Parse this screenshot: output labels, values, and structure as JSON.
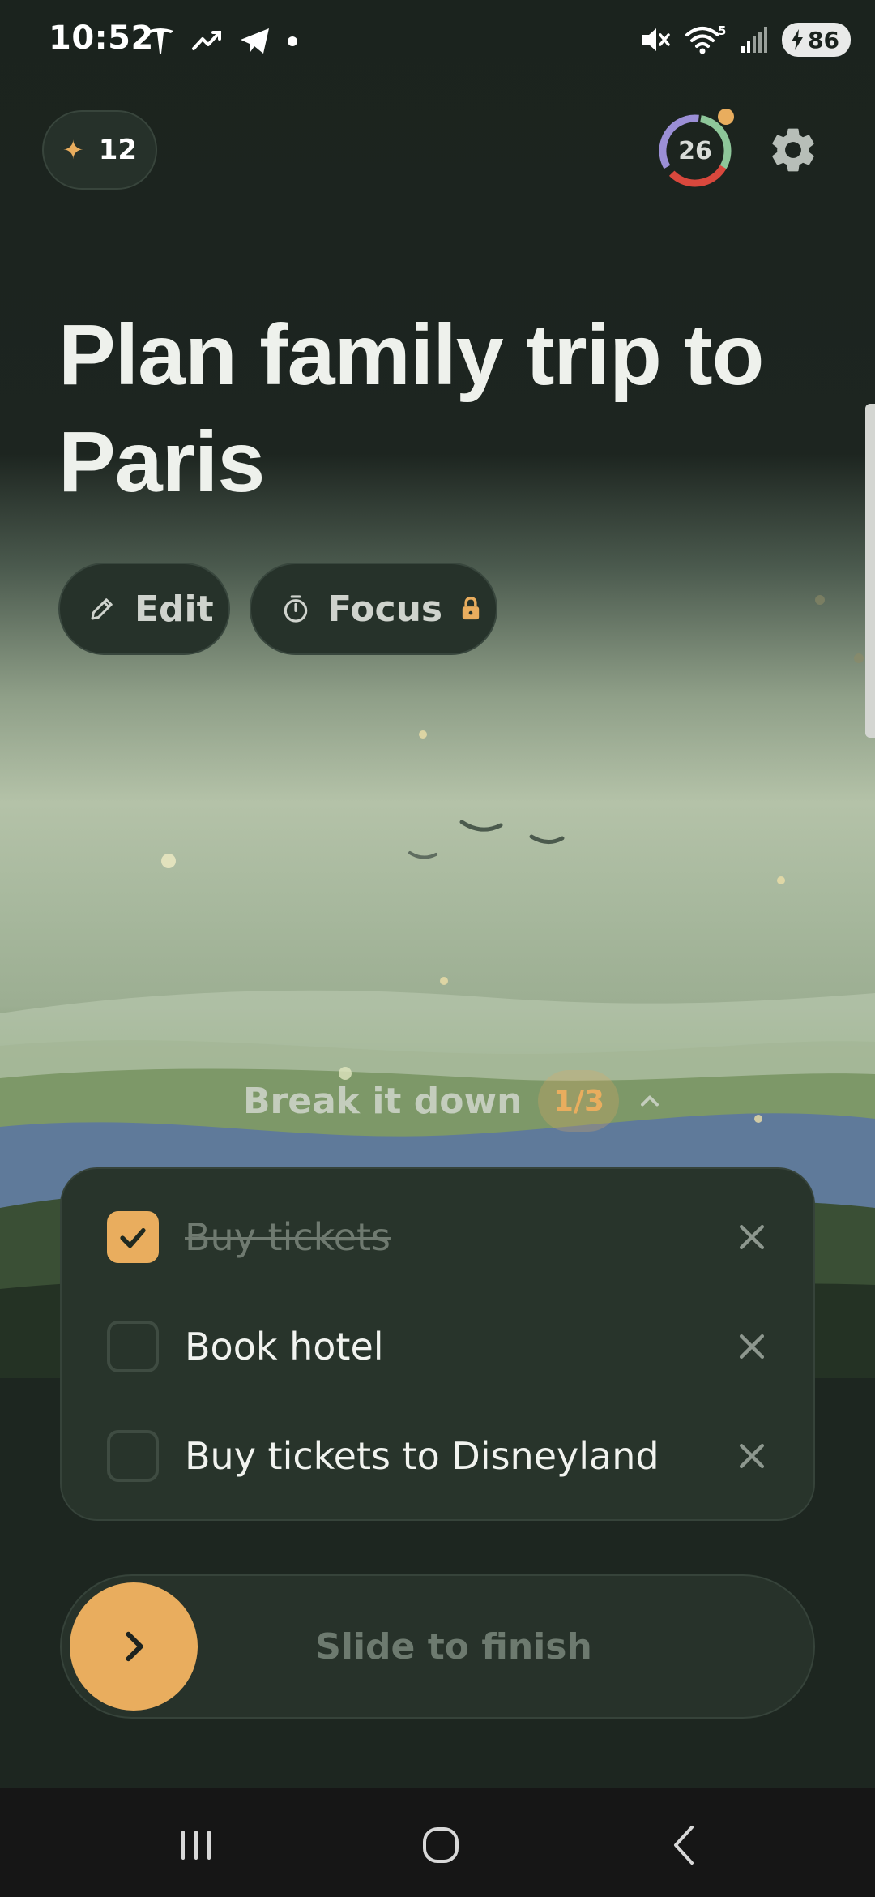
{
  "status_bar": {
    "time": "10:52",
    "left_icons": [
      "tesla-icon",
      "trending-icon",
      "telegram-icon",
      "dot-icon"
    ],
    "right_icons": [
      "mute-icon",
      "wifi-icon",
      "signal-icon"
    ],
    "wifi_label": "5",
    "battery_level": "86"
  },
  "header": {
    "streak_count": "12",
    "ring_count": "26",
    "ring_colors": [
      "#9b8fd6",
      "#8ec79a",
      "#d9483d"
    ]
  },
  "task": {
    "title": "Plan family trip to Paris"
  },
  "actions": {
    "edit_label": "Edit",
    "focus_label": "Focus"
  },
  "breakdown": {
    "label": "Break it down",
    "count": "1/3",
    "subtasks": [
      {
        "label": "Buy tickets",
        "done": true
      },
      {
        "label": "Book hotel",
        "done": false
      },
      {
        "label": "Buy tickets to Disneyland",
        "done": false
      }
    ]
  },
  "slider": {
    "label": "Slide to finish"
  },
  "colors": {
    "accent": "#e9ad5e",
    "background": "#1b231e",
    "card": "#28342b"
  }
}
